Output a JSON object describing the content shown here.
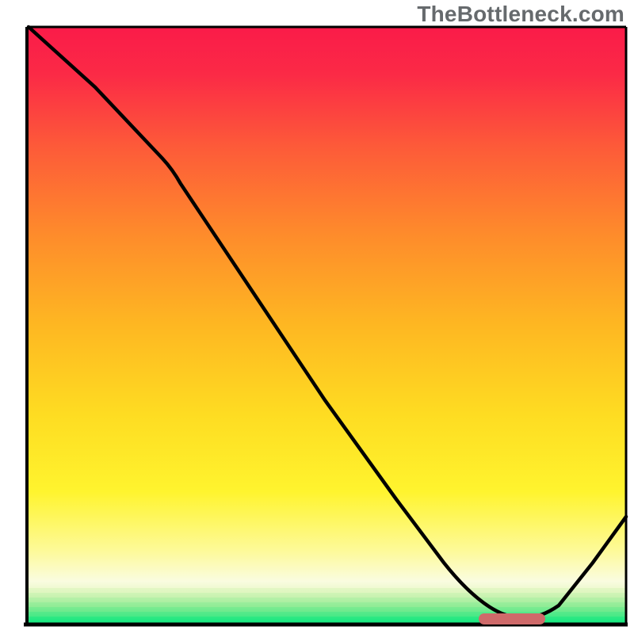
{
  "watermark": "TheBottleneck.com",
  "chart_data": {
    "type": "line",
    "title": "",
    "xlabel": "",
    "ylabel": "",
    "xlim": [
      0,
      100
    ],
    "ylim": [
      0,
      100
    ],
    "grid": false,
    "legend": false,
    "series": [
      {
        "name": "bottleneck-curve",
        "x": [
          5,
          12,
          20,
          26,
          32,
          38,
          44,
          50,
          56,
          62,
          68,
          74,
          78,
          82,
          86,
          92,
          100
        ],
        "y": [
          100,
          92,
          83,
          76,
          66,
          56,
          47,
          37,
          28,
          19,
          11,
          4,
          1,
          0,
          1,
          6,
          16
        ]
      }
    ],
    "annotations": [
      {
        "name": "optimal-marker",
        "shape": "rounded-bar",
        "x_range": [
          76,
          86
        ],
        "y": 0.8,
        "color": "#cf6a6a"
      }
    ],
    "gradient_bands": [
      {
        "y_from": 99,
        "y_to": 100,
        "color": "#f91949"
      },
      {
        "y_from": 60,
        "y_to": 99,
        "color": "linear #fa1c48 -> #fea321"
      },
      {
        "y_from": 20,
        "y_to": 60,
        "color": "linear #fea321 -> #fff128"
      },
      {
        "y_from": 6,
        "y_to": 20,
        "color": "linear #fff128 -> #fbfbc9"
      },
      {
        "y_from": 1,
        "y_to": 6,
        "color": "banded pale-green"
      },
      {
        "y_from": 0,
        "y_to": 1,
        "color": "#15e880"
      }
    ]
  }
}
